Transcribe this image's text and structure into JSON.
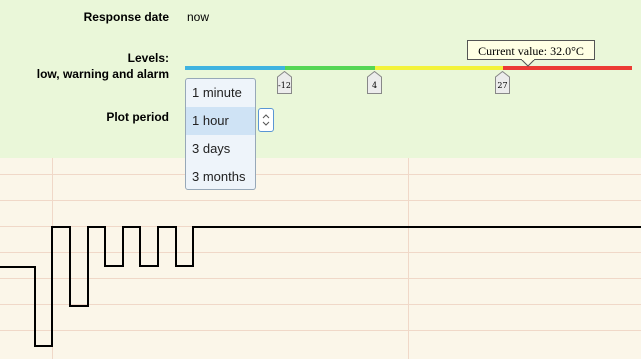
{
  "settings": {
    "response_date_label": "Response date",
    "response_date_value": "now",
    "levels_label_line1": "Levels:",
    "levels_label_line2": "low, warning and alarm",
    "plot_period_label": "Plot period"
  },
  "levels": {
    "tooltip": "Current value: 32.0°C",
    "markers": [
      "-12",
      "4",
      "27"
    ],
    "colors": {
      "low": "#3fb3e0",
      "normal": "#55d655",
      "warning": "#f3f33a",
      "alarm": "#ec3b34"
    }
  },
  "plot_period": {
    "options": [
      "1 minute",
      "1 hour",
      "3 days",
      "3 months"
    ],
    "selected": "1 hour"
  },
  "plot": {
    "grid_color": "#f0d8c8",
    "line_color": "#000000"
  }
}
